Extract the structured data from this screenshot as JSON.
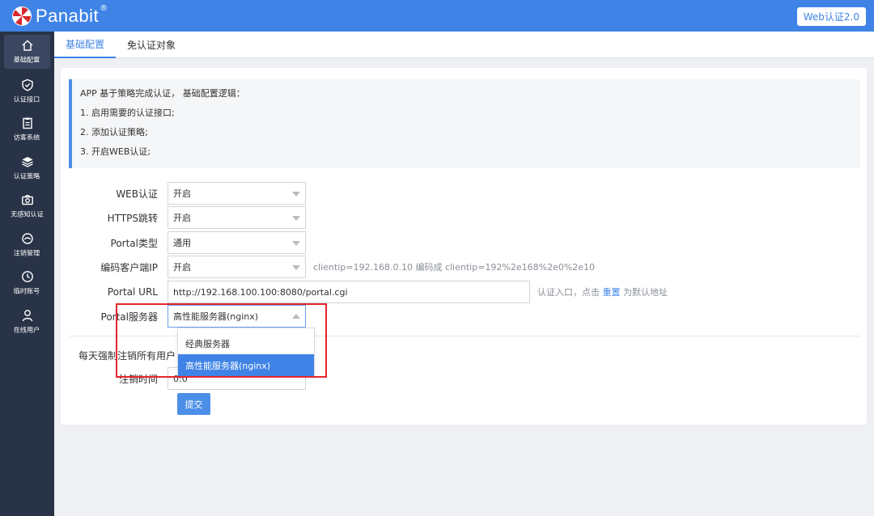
{
  "brand": {
    "name": "Panabit",
    "reg": "®"
  },
  "top_button": "Web认证2.0",
  "sidebar": {
    "items": [
      {
        "label": "基础配置",
        "icon": "home-icon",
        "active": true
      },
      {
        "label": "认证接口",
        "icon": "shield-check-icon"
      },
      {
        "label": "访客系统",
        "icon": "clipboard-icon"
      },
      {
        "label": "认证策略",
        "icon": "layers-icon"
      },
      {
        "label": "无感知认证",
        "icon": "camera-icon"
      },
      {
        "label": "注销管理",
        "icon": "unlink-icon"
      },
      {
        "label": "临时账号",
        "icon": "clock-icon"
      },
      {
        "label": "在线用户",
        "icon": "user-icon"
      }
    ]
  },
  "tabs": [
    {
      "label": "基础配置",
      "active": true
    },
    {
      "label": "免认证对象",
      "active": false
    }
  ],
  "info": {
    "lines": [
      "APP 基于策略完成认证， 基础配置逻辑：",
      "1. 启用需要的认证接口;",
      "2. 添加认证策略;",
      "3. 开启WEB认证;"
    ]
  },
  "form": {
    "web_auth": {
      "label": "WEB认证",
      "value": "开启"
    },
    "https_redirect": {
      "label": "HTTPS跳转",
      "value": "开启"
    },
    "portal_type": {
      "label": "Portal类型",
      "value": "通用"
    },
    "encode_ip": {
      "label": "编码客户端IP",
      "value": "开启",
      "hint": "clientip=192.168.0.10 编码成 clientip=192%2e168%2e0%2e10"
    },
    "portal_url": {
      "label": "Portal URL",
      "value": "http://192.168.100.100:8080/portal.cgi",
      "hint_pre": "认证入口，点击 ",
      "hint_link": "重置",
      "hint_post": " 为默认地址"
    },
    "portal_server": {
      "label": "Portal服务器",
      "value": "高性能服务器(nginx)"
    },
    "force_logout_label": "每天强制注销所有用户",
    "logout_time": {
      "label": "注销时间",
      "value": "0:0"
    },
    "submit_label": "提交"
  },
  "dropdown": {
    "options": [
      "经典服务器",
      "高性能服务器(nginx)"
    ],
    "selected": 1
  },
  "colors": {
    "primary": "#3f83e6",
    "sidebar": "#293347",
    "highlight": "#e5262d"
  }
}
